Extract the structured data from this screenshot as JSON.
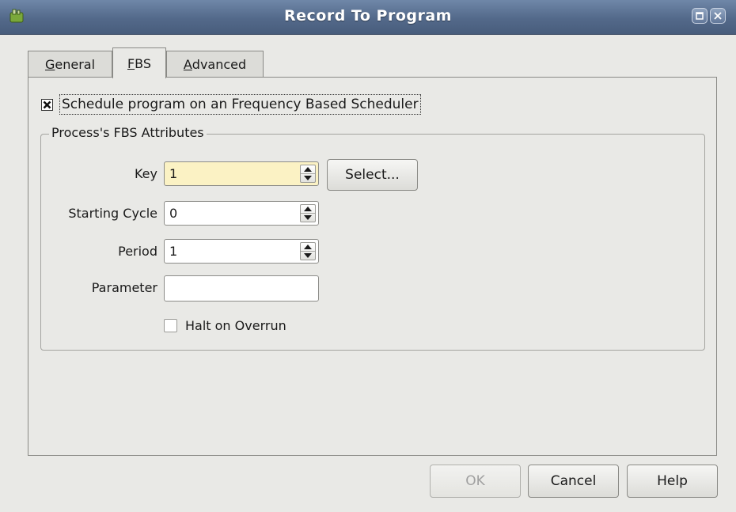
{
  "window": {
    "title": "Record To Program",
    "icons": {
      "app": "app-icon",
      "maximize": "maximize-icon",
      "close": "close-icon"
    }
  },
  "tabs": [
    {
      "label_first": "G",
      "label_rest": "eneral",
      "active": false
    },
    {
      "label_first": "F",
      "label_rest": "BS",
      "active": true
    },
    {
      "label_first": "A",
      "label_rest": "dvanced",
      "active": false
    }
  ],
  "fbs": {
    "schedule_checkbox": {
      "label": "Schedule program on an Frequency Based Scheduler",
      "checked": true
    },
    "group_title": "Process's FBS Attributes",
    "fields": {
      "key": {
        "label": "Key",
        "value": "1"
      },
      "starting_cycle": {
        "label": "Starting Cycle",
        "value": "0"
      },
      "period": {
        "label": "Period",
        "value": "1"
      },
      "parameter": {
        "label": "Parameter",
        "value": ""
      }
    },
    "select_button": "Select...",
    "halt_checkbox": {
      "label": "Halt on Overrun",
      "checked": false
    }
  },
  "buttons": {
    "ok": "OK",
    "cancel": "Cancel",
    "help": "Help"
  },
  "colors": {
    "titlebar": "#53698a",
    "focused_input": "#fbf2c4",
    "window_bg": "#e9e9e6"
  }
}
